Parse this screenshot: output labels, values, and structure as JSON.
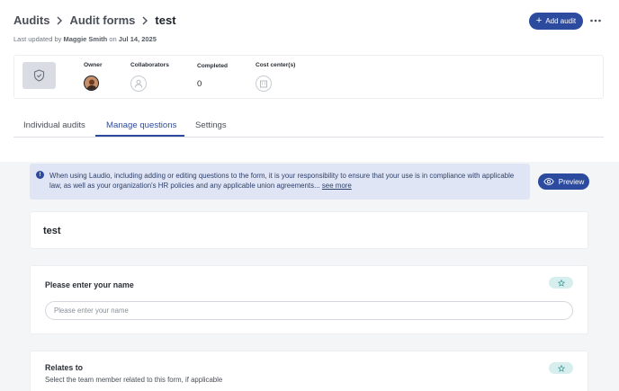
{
  "breadcrumb": {
    "items": [
      "Audits",
      "Audit forms"
    ],
    "current": "test"
  },
  "last_updated": {
    "prefix": "Last updated by",
    "user": "Maggie Smith",
    "on": "on",
    "date": "Jul 14, 2025"
  },
  "header": {
    "add_button": "Add audit",
    "more_icon": "more-horizontal-icon"
  },
  "info_card": {
    "owner_label": "Owner",
    "collaborators_label": "Collaborators",
    "completed_label": "Completed",
    "completed_value": "0",
    "cost_centers_label": "Cost center(s)"
  },
  "tabs": [
    {
      "label": "Individual audits",
      "active": false
    },
    {
      "label": "Manage questions",
      "active": true
    },
    {
      "label": "Settings",
      "active": false
    }
  ],
  "notice": {
    "text": "When using Laudio, including adding or editing questions to the form, it is your responsibility to ensure that your use is in compliance with applicable law, as well as your organization's HR policies and any applicable union agreements...",
    "link": "see more"
  },
  "preview_button": "Preview",
  "form": {
    "title": "test"
  },
  "questions": [
    {
      "title": "Please enter your name",
      "placeholder": "Please enter your name"
    },
    {
      "title": "Relates to",
      "subtitle": "Select the team member related to this form, if applicable"
    }
  ],
  "colors": {
    "primary": "#2d4b9e",
    "notice_bg": "#dfe5f4",
    "chip_bg": "#d6efee",
    "page_bg": "#f4f5f7"
  }
}
